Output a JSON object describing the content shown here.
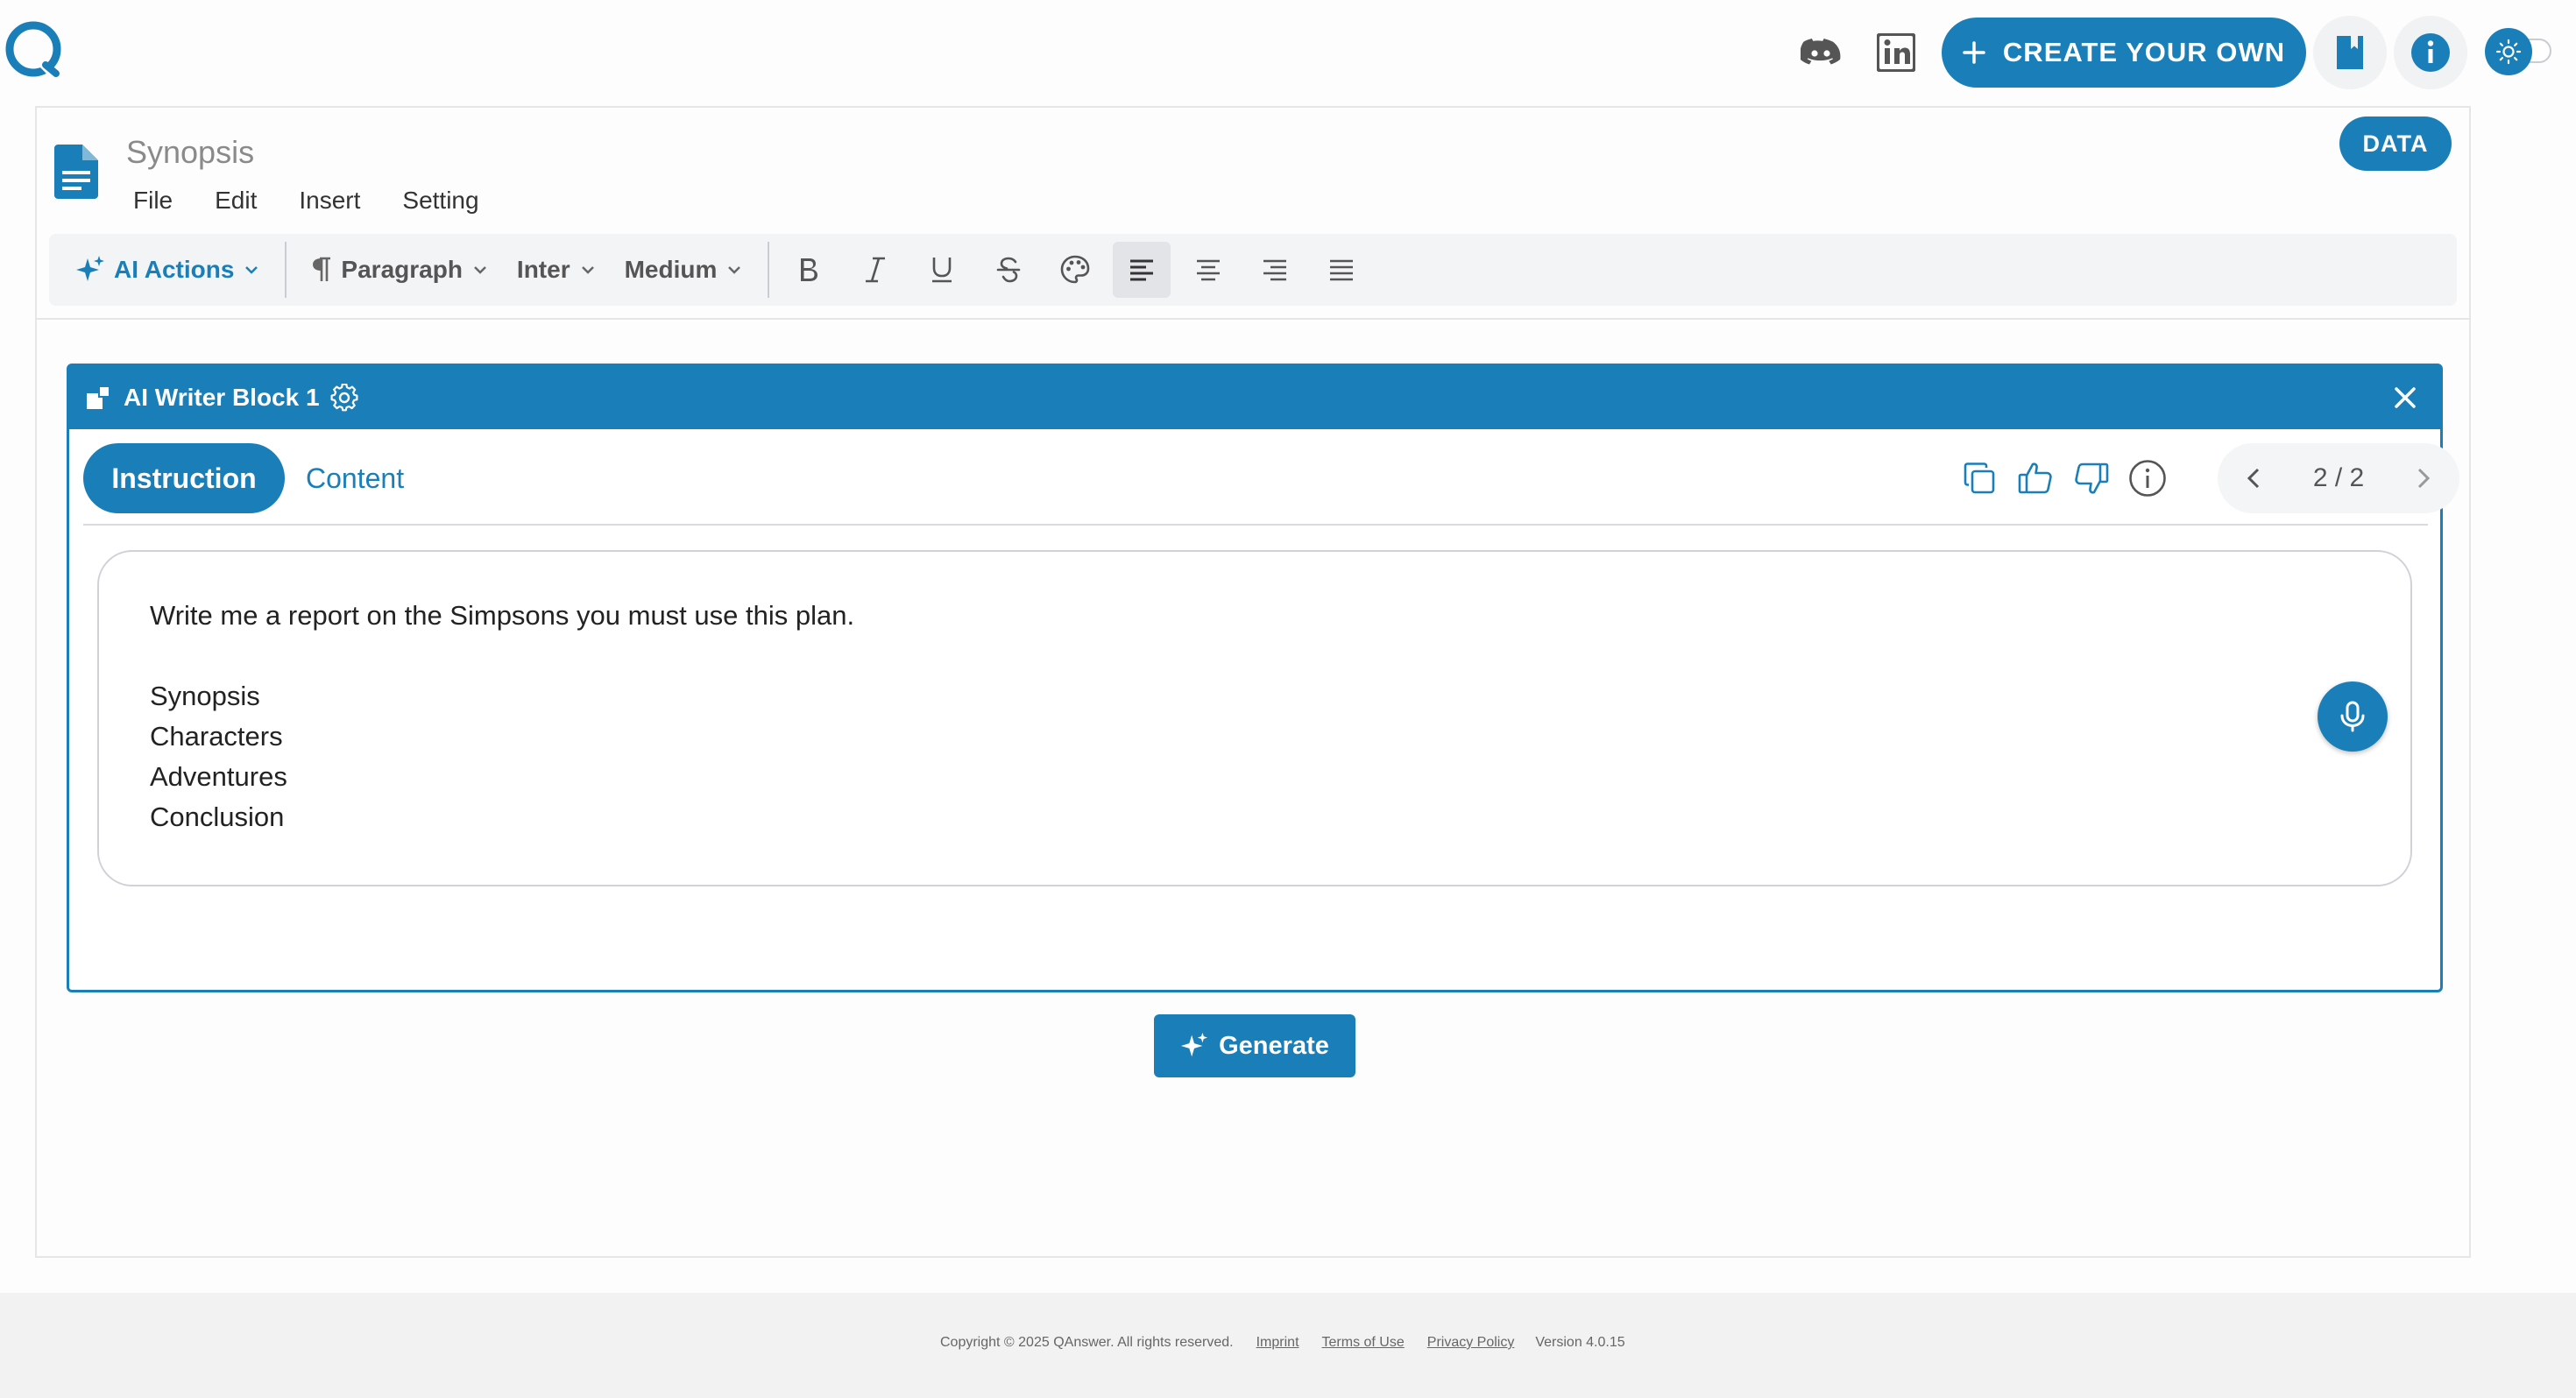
{
  "colors": {
    "accent": "#1a7fb8",
    "toolbar_bg": "#f2f4f6",
    "footer_bg": "#f2f2f2"
  },
  "topbar": {
    "logo": "qanswer-logo",
    "icons": [
      "discord-icon",
      "linkedin-icon"
    ],
    "create_label": "CREATE YOUR OWN",
    "buttons": [
      "bookmark-icon",
      "info-icon"
    ],
    "theme_toggle": "sun-icon"
  },
  "document": {
    "title": "Synopsis",
    "menu": [
      "File",
      "Edit",
      "Insert",
      "Setting"
    ],
    "data_button": "DATA",
    "toolbar": {
      "ai_actions": "AI Actions",
      "paragraph": "Paragraph",
      "font": "Inter",
      "weight": "Medium",
      "format_icons": [
        "bold-icon",
        "italic-icon",
        "underline-icon",
        "strikethrough-icon",
        "palette-icon",
        "align-left-icon",
        "align-center-icon",
        "align-right-icon",
        "align-justify-icon"
      ],
      "active_alignment": "align-left"
    }
  },
  "ai_block": {
    "title": "AI Writer Block 1",
    "tabs": {
      "instruction": "Instruction",
      "content": "Content"
    },
    "active_tab": "Instruction",
    "pager": "2 / 2",
    "instruction_text": "Write me a report on the Simpsons you must use this plan.\n\nSynopsis\nCharacters\nAdventures\nConclusion",
    "generate_label": "Generate"
  },
  "footer": {
    "copyright": "Copyright © 2025 QAnswer. All rights reserved.",
    "links": [
      "Imprint",
      "Terms of Use",
      "Privacy Policy"
    ],
    "version": "Version 4.0.15"
  }
}
